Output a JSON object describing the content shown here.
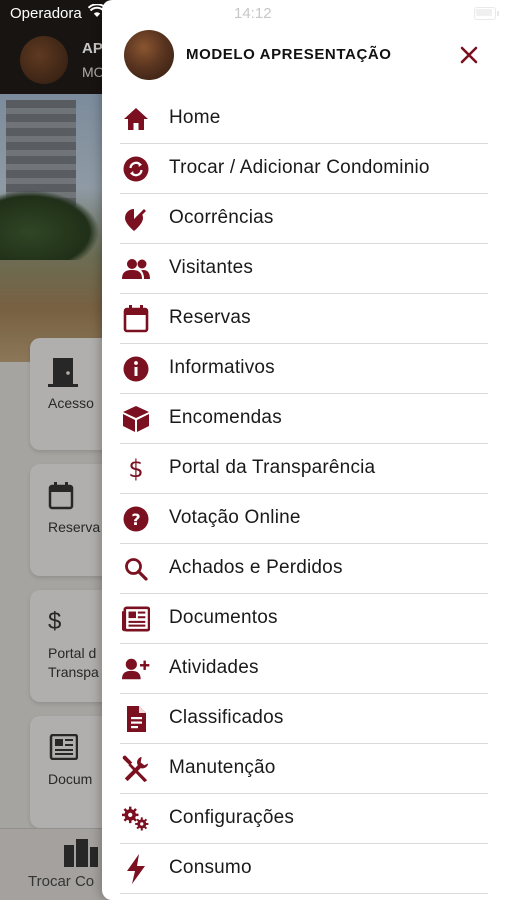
{
  "status_bar": {
    "carrier": "Operadora",
    "time": "14:12"
  },
  "background": {
    "header_title": "AP",
    "header_subtitle": "MO",
    "cards": [
      {
        "label": "Acesso",
        "icon": "door-icon"
      },
      {
        "label": "Reserva",
        "icon": "calendar-icon"
      },
      {
        "label": "Portal d Transpa",
        "icon": "dollar-icon"
      },
      {
        "label": "Docum",
        "icon": "newspaper-icon"
      }
    ],
    "tab_label": "Trocar Co"
  },
  "drawer": {
    "profile_name": "MODELO APRESENTAÇÃO",
    "accent_color": "#7a1020",
    "menu": [
      {
        "label": "Home",
        "icon": "home-icon"
      },
      {
        "label": "Trocar / Adicionar Condominio",
        "icon": "swap-icon"
      },
      {
        "label": "Ocorrências",
        "icon": "pin-edit-icon"
      },
      {
        "label": "Visitantes",
        "icon": "people-icon"
      },
      {
        "label": "Reservas",
        "icon": "calendar-icon"
      },
      {
        "label": "Informativos",
        "icon": "info-icon"
      },
      {
        "label": "Encomendas",
        "icon": "package-icon"
      },
      {
        "label": "Portal da Transparência",
        "icon": "dollar-icon"
      },
      {
        "label": "Votação Online",
        "icon": "question-icon"
      },
      {
        "label": "Achados e Perdidos",
        "icon": "search-icon"
      },
      {
        "label": "Documentos",
        "icon": "newspaper-icon"
      },
      {
        "label": "Atividades",
        "icon": "person-add-icon"
      },
      {
        "label": "Classificados",
        "icon": "document-icon"
      },
      {
        "label": "Manutenção",
        "icon": "tools-icon"
      },
      {
        "label": "Configurações",
        "icon": "gears-icon"
      },
      {
        "label": "Consumo",
        "icon": "lightning-icon"
      }
    ]
  }
}
